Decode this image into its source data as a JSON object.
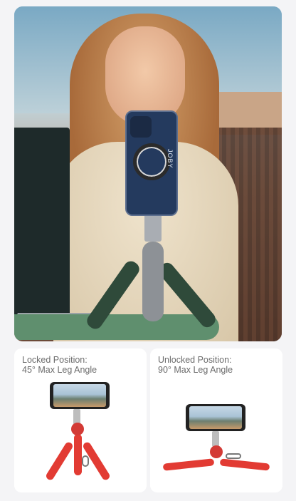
{
  "hero": {
    "brand_text": "JOBY"
  },
  "cards": {
    "locked": {
      "line1": "Locked Position:",
      "line2": "45° Max Leg Angle"
    },
    "unlocked": {
      "line1": "Unlocked Position:",
      "line2": "90° Max Leg Angle"
    }
  },
  "colors": {
    "background": "#f4f4f6",
    "card": "#ffffff",
    "text": "#6b6b6b",
    "tripod_red": "#e23b33",
    "tripod_green": "#2f4a3a"
  }
}
